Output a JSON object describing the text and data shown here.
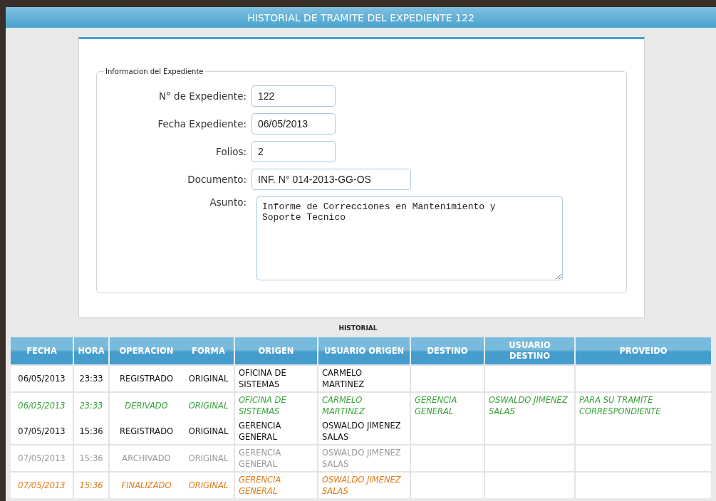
{
  "title": "HISTORIAL DE TRAMITE DEL EXPEDIENTE 122",
  "form": {
    "legend": "Informacion del Expediente",
    "fields": [
      {
        "label": "N° de Expediente:",
        "value": "122",
        "kind": "short"
      },
      {
        "label": "Fecha Expediente:",
        "value": "06/05/2013",
        "kind": "short"
      },
      {
        "label": "Folios:",
        "value": "2",
        "kind": "short"
      },
      {
        "label": "Documento:",
        "value": "INF. N° 014-2013-GG-OS",
        "kind": "long"
      },
      {
        "label": "Asunto:",
        "value": "Informe de Correcciones en Mantenimiento y\nSoporte Tecnico",
        "kind": "area"
      }
    ]
  },
  "history": {
    "caption": "HISTORIAL",
    "columns": [
      "FECHA",
      "HORA",
      "OPERACION",
      "FORMA",
      "ORIGEN",
      "USUARIO ORIGEN",
      "DESTINO",
      "USUARIO DESTINO",
      "PROVEIDO"
    ],
    "groups": [
      {
        "entries": [
          {
            "kind": "registrado",
            "fecha": "06/05/2013",
            "hora": "23:33",
            "operacion": "REGISTRADO",
            "forma": "ORIGINAL",
            "origen": "OFICINA DE SISTEMAS",
            "usuario_origen": "CARMELO MARTINEZ"
          }
        ]
      },
      {
        "destino": "GERENCIA GENERAL",
        "usuario_destino": "OSWALDO JIMENEZ SALAS",
        "proveido": "PARA SU TRAMITE CORRESPONDIENTE",
        "kind": "derivado",
        "entries": [
          {
            "kind": "derivado",
            "fecha": "06/05/2013",
            "hora": "23:33",
            "operacion": "DERIVADO",
            "forma": "ORIGINAL",
            "origen": "OFICINA DE SISTEMAS",
            "usuario_origen": "CARMELO MARTINEZ"
          },
          {
            "kind": "registrado",
            "fecha": "07/05/2013",
            "hora": "15:36",
            "operacion": "REGISTRADO",
            "forma": "ORIGINAL",
            "origen": "GERENCIA GENERAL",
            "usuario_origen": "OSWALDO JIMENEZ SALAS"
          }
        ]
      },
      {
        "entries": [
          {
            "kind": "archivado",
            "fecha": "07/05/2013",
            "hora": "15:36",
            "operacion": "ARCHIVADO",
            "forma": "ORIGINAL",
            "origen": "GERENCIA GENERAL",
            "usuario_origen": "OSWALDO JIMENEZ SALAS"
          }
        ]
      },
      {
        "entries": [
          {
            "kind": "finalizado",
            "fecha": "07/05/2013",
            "hora": "15:36",
            "operacion": "FINALIZADO",
            "forma": "ORIGINAL",
            "origen": "GERENCIA GENERAL",
            "usuario_origen": "OSWALDO JIMENEZ SALAS"
          }
        ]
      }
    ]
  }
}
